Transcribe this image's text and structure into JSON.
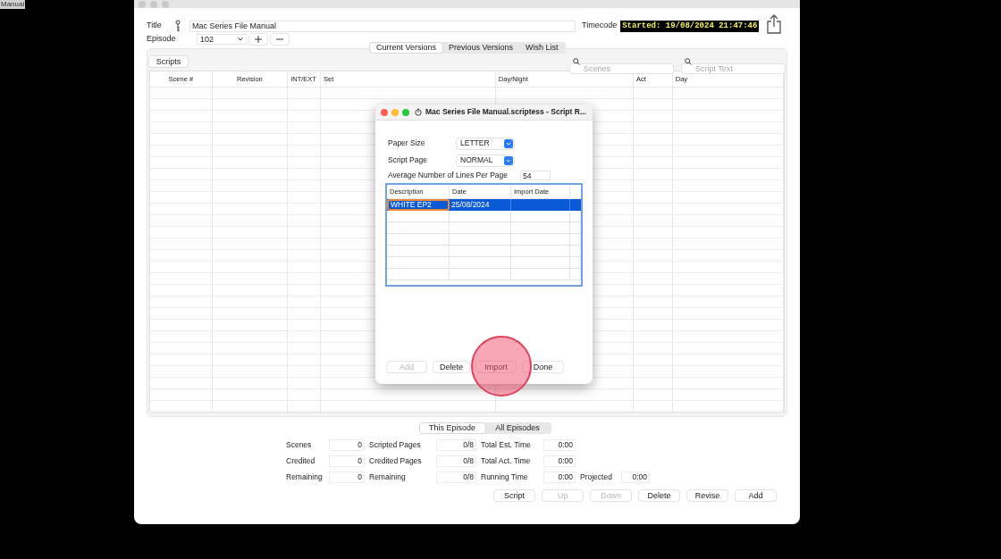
{
  "desktop_label": "Manual",
  "header": {
    "title_label": "Title",
    "title_value": "Mac Series File Manual",
    "timecode_label": "Timecode",
    "timecode_value": "Started: 19/08/2024 21:47:46",
    "episode_label": "Episode",
    "episode_value": "102"
  },
  "version_tabs": [
    {
      "label": "Current Versions",
      "selected": true
    },
    {
      "label": "Previous Versions",
      "selected": false
    },
    {
      "label": "Wish List",
      "selected": false
    }
  ],
  "scripts_button": "Scripts",
  "search_fields": [
    {
      "placeholder": "Scenes"
    },
    {
      "placeholder": "Script Text"
    }
  ],
  "table": {
    "columns": [
      "Scene #",
      "Revision",
      "INT/EXT",
      "Set",
      "Day/Night",
      "Act",
      "Day"
    ]
  },
  "scope_tabs": [
    {
      "label": "This Episode",
      "selected": true
    },
    {
      "label": "All Episodes",
      "selected": false
    }
  ],
  "stats": [
    [
      {
        "label": "Scenes",
        "value": "0"
      },
      {
        "label": "Scripted Pages",
        "value": "0/8"
      },
      {
        "label": "Total Est. Time",
        "value": "0:00"
      }
    ],
    [
      {
        "label": "Credited",
        "value": "0"
      },
      {
        "label": "Credited Pages",
        "value": "0/8"
      },
      {
        "label": "Total Act. Time",
        "value": "0:00"
      }
    ],
    [
      {
        "label": "Remaining",
        "value": "0"
      },
      {
        "label": "Remaining",
        "value": "0/8"
      },
      {
        "label": "Running Time",
        "value": "0:00"
      },
      {
        "label": "Projected",
        "value": "0:00"
      }
    ]
  ],
  "buttons": [
    {
      "label": "Script",
      "disabled": false
    },
    {
      "label": "Up",
      "disabled": true
    },
    {
      "label": "Down",
      "disabled": true
    },
    {
      "label": "Delete",
      "disabled": false
    },
    {
      "label": "Revise",
      "disabled": false
    },
    {
      "label": "Add",
      "disabled": false
    }
  ],
  "dialog": {
    "title": "Mac Series File Manual.scriptess - Script R...",
    "paper_size_label": "Paper Size",
    "paper_size": "LETTER",
    "script_page_label": "Script Page",
    "script_page": "NORMAL",
    "lines_label": "Average Number of Lines Per Page",
    "lines_value": "54",
    "table": {
      "columns": [
        "Description",
        "Date",
        "Import Date"
      ],
      "rows": [
        {
          "selected": true,
          "cells": [
            {
              "text": "WHITE EP2",
              "highlighted": true
            },
            {
              "text": "25/08/2024",
              "highlighted": false
            },
            {
              "text": "",
              "highlighted": false
            }
          ]
        }
      ]
    },
    "buttons": [
      {
        "label": "Add",
        "disabled": true
      },
      {
        "label": "Delete",
        "disabled": false
      },
      {
        "label": "Import",
        "disabled": false
      },
      {
        "label": "Done",
        "disabled": false
      }
    ]
  }
}
